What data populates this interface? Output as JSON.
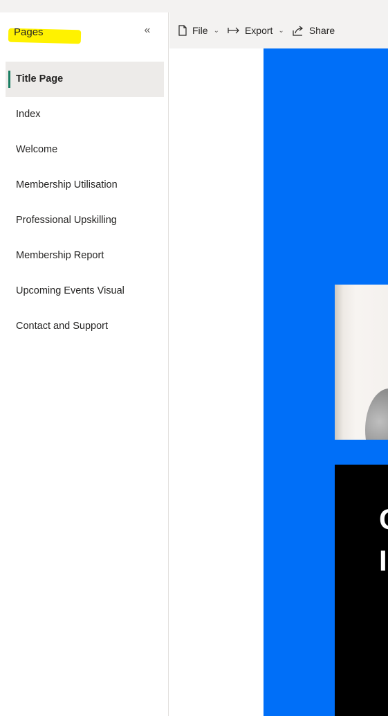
{
  "pages_pane": {
    "title": "Pages",
    "collapse_icon": "double-chevron-left-icon",
    "items": [
      {
        "label": "Title Page",
        "active": true
      },
      {
        "label": "Index"
      },
      {
        "label": "Welcome"
      },
      {
        "label": "Membership Utilisation"
      },
      {
        "label": "Professional Upskilling"
      },
      {
        "label": "Membership Report"
      },
      {
        "label": "Upcoming Events Visual"
      },
      {
        "label": "Contact and Support"
      }
    ]
  },
  "toolbar": {
    "file_label": "File",
    "export_label": "Export",
    "share_label": "Share"
  },
  "report": {
    "heading_line1": "C",
    "heading_line2": "I"
  },
  "colors": {
    "report_background": "#006ff8",
    "active_indicator": "#1a7e63",
    "annotation_highlight": "#fff200"
  }
}
